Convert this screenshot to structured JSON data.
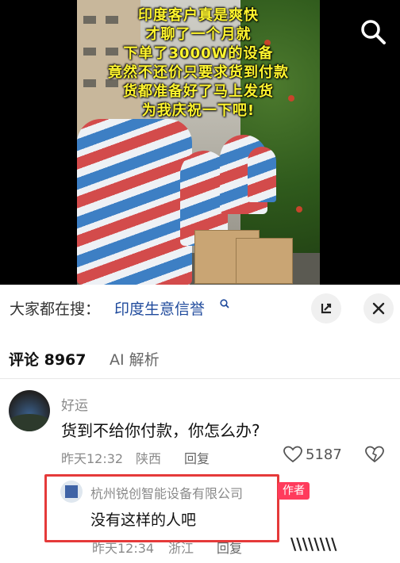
{
  "video": {
    "caption_lines": [
      "印度客户真是爽快",
      "才聊了一个月就",
      "下单了3000W的设备",
      "竟然不还价只要求货到付款",
      "货都准备好了马上发货",
      "为我庆祝一下吧!"
    ]
  },
  "search_suggest": {
    "label": "大家都在搜：",
    "query": "印度生意信誉",
    "query_icon": "search-small-icon"
  },
  "tabs": [
    {
      "label": "评论 8967"
    },
    {
      "label": "AI 解析"
    }
  ],
  "comment": {
    "username": "好运",
    "text": "货到不给你付款，你怎么办?",
    "time": "昨天12:32",
    "location": "陕西",
    "reply_label": "回复",
    "likes": "5187"
  },
  "reply": {
    "username": "杭州锐创智能设备有限公司",
    "badge": "作者",
    "text": "没有这样的人吧",
    "time": "昨天12:34",
    "location": "浙江",
    "reply_label": "回复"
  },
  "watermark": "\\\\\\\\\\\\\\\\",
  "colors": {
    "accent_link": "#1f4a9c",
    "highlight_box": "#e53a3a",
    "author_badge": "#ff3b5c",
    "caption": "#fff52e"
  }
}
